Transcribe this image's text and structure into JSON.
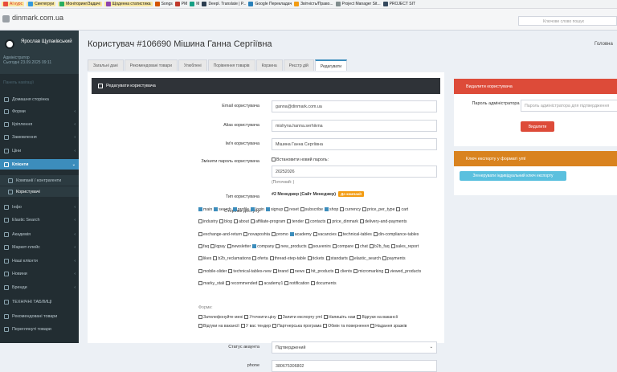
{
  "bookmarks": [
    "AI курс",
    "Синтегруи",
    "Моніторинг/Задачі",
    "Щоденна статистика",
    "Songs",
    "PM",
    "M",
    "Deepl. Translate | Р...",
    "Google Перекладач",
    "Звітність/Право...",
    "Project Manager Sit...",
    "PROJECT SIT"
  ],
  "site": "dinmark.com.ua",
  "search_placeholder": "Ключове слово пошук",
  "user": {
    "name": "Ярослав Щупаківський",
    "role": "Адміністратор",
    "today": "Сьогодні 23.09.2025 09:11"
  },
  "nav_header": "Панель навігації",
  "menu": [
    {
      "label": "Домашня сторінка",
      "chev": ""
    },
    {
      "label": "Форми",
      "chev": "‹"
    },
    {
      "label": "Кріплення",
      "chev": "‹"
    },
    {
      "label": "Замовлення",
      "chev": "‹"
    },
    {
      "label": "Ціни",
      "chev": "‹"
    },
    {
      "label": "Клієнти",
      "chev": "⌄"
    },
    {
      "label": "Компанії / контрагенти",
      "chev": ""
    },
    {
      "label": "Користувачі",
      "chev": ""
    },
    {
      "label": "Інфо",
      "chev": "‹"
    },
    {
      "label": "Elastic Search",
      "chev": "‹"
    },
    {
      "label": "Академія",
      "chev": "‹"
    },
    {
      "label": "Маркет-плейс",
      "chev": "‹"
    },
    {
      "label": "Наші клієнти",
      "chev": "‹"
    },
    {
      "label": "Новини",
      "chev": "‹"
    },
    {
      "label": "Бренди",
      "chev": "‹"
    },
    {
      "label": "ТЕХНІЧНІ ТАБЛИЦІ",
      "chev": ""
    },
    {
      "label": "Рекомендовані товари",
      "chev": ""
    },
    {
      "label": "Переглянуті товари",
      "chev": ""
    }
  ],
  "page_title": "Користувач #106690 Мішина Ганна Сергіївна",
  "breadcrumb": "Головна",
  "tabs": [
    "Загальні дані",
    "Рекомендовані товари",
    "Улюблені",
    "Порівняння товарів",
    "Корзина",
    "Реєстр дій",
    "Редагувати"
  ],
  "panel_title": "Редагувати користувача",
  "form": {
    "email_label": "Email користувача",
    "email": "ganna@dinmark.com.ua",
    "alias_label": "Alias користувача",
    "alias": "mishyna.hanna.serhiivna",
    "name_label": "Ім'я користувача",
    "name": "Мішина Ганна Сергіївна",
    "pass_label": "Змінити пароль користувача",
    "pass_check": "Встановити новий пароль:",
    "pass_value": "20252026",
    "pass_hint": "(Поточний: )",
    "type_label": "Тип користувача",
    "type_value": "#2 Менеджер (Сайт Менеджер)",
    "type_badge": "До компанії",
    "pages_label": "Сторінки доступу",
    "forms_caption": "Форми:",
    "status_label": "Статус акаунта",
    "status_value": "Підтверджений",
    "phone_label": "phone",
    "phone_value": "380675306802"
  },
  "access_rows": [
    [
      {
        "t": "main",
        "c": true
      },
      {
        "t": "search",
        "c": true
      },
      {
        "t": "profile",
        "c": true
      },
      {
        "t": "login",
        "c": true
      },
      {
        "t": "signup",
        "c": true
      },
      {
        "t": "reset",
        "c": false
      },
      {
        "t": "subscribe",
        "c": false
      },
      {
        "t": "shop",
        "c": true
      },
      {
        "t": "currency",
        "c": false
      },
      {
        "t": "price_per_type",
        "c": false
      },
      {
        "t": "cart",
        "c": false
      }
    ],
    [
      {
        "t": "industry",
        "c": false
      },
      {
        "t": "blog",
        "c": false
      },
      {
        "t": "about",
        "c": false
      },
      {
        "t": "affiliate-program",
        "c": false
      },
      {
        "t": "tender",
        "c": false
      },
      {
        "t": "contacts",
        "c": false
      },
      {
        "t": "price_dinmark",
        "c": false
      },
      {
        "t": "delivery-and-payments",
        "c": false
      }
    ],
    [
      {
        "t": "exchange-and-return",
        "c": false
      },
      {
        "t": "novaposhta",
        "c": false
      },
      {
        "t": "promo",
        "c": false
      },
      {
        "t": "academy",
        "c": true
      },
      {
        "t": "vacancies",
        "c": false
      },
      {
        "t": "technical-tables",
        "c": false
      },
      {
        "t": "din-compliance-tables",
        "c": false
      }
    ],
    [
      {
        "t": "faq",
        "c": false
      },
      {
        "t": "lqpay",
        "c": false
      },
      {
        "t": "newsletter",
        "c": false
      },
      {
        "t": "company",
        "c": true
      },
      {
        "t": "new_products",
        "c": false
      },
      {
        "t": "souvenirs",
        "c": false
      },
      {
        "t": "compare",
        "c": false
      },
      {
        "t": "chat",
        "c": false
      },
      {
        "t": "b2b_faq",
        "c": false
      },
      {
        "t": "sales_report",
        "c": false
      }
    ],
    [
      {
        "t": "likes",
        "c": false
      },
      {
        "t": "b2b_reclamations",
        "c": false
      },
      {
        "t": "oferta",
        "c": false
      },
      {
        "t": "thread-step-table",
        "c": false
      },
      {
        "t": "tickets",
        "c": false
      },
      {
        "t": "standarts",
        "c": false
      },
      {
        "t": "elastic_search",
        "c": false
      },
      {
        "t": "payments",
        "c": false
      }
    ],
    [
      {
        "t": "mobile-slider",
        "c": false
      },
      {
        "t": "technical-tables-new",
        "c": false
      },
      {
        "t": "brand",
        "c": false
      },
      {
        "t": "news",
        "c": false
      },
      {
        "t": "hit_products",
        "c": false
      },
      {
        "t": "clients",
        "c": false
      },
      {
        "t": "micromarking",
        "c": false
      },
      {
        "t": "viewed_products",
        "c": false
      }
    ],
    [
      {
        "t": "marky_stali",
        "c": false
      },
      {
        "t": "recommended",
        "c": false
      },
      {
        "t": "academy1",
        "c": false
      },
      {
        "t": "notification",
        "c": false
      },
      {
        "t": "documents",
        "c": false
      }
    ]
  ],
  "form_rows": [
    [
      {
        "t": "Зателефонуйте мені",
        "c": false
      },
      {
        "t": "Уточнити ціну",
        "c": false
      },
      {
        "t": "Запити експорту yml",
        "c": false
      },
      {
        "t": "Напишіть нам",
        "c": false
      },
      {
        "t": "Відгуки на вакансії",
        "c": false
      }
    ],
    [
      {
        "t": "Відгуки на вакансії",
        "c": false
      },
      {
        "t": "У вас тендер",
        "c": false
      },
      {
        "t": "Партнерська програма",
        "c": false
      },
      {
        "t": "Обмін та повернення",
        "c": false
      },
      {
        "t": "Надання зразків",
        "c": false
      }
    ]
  ],
  "right": {
    "del_title": "Видалити користувача",
    "del_label": "Пароль адміністратора",
    "del_placeholder": "Пароль адміністратора для підтвердження",
    "del_button": "Видалити",
    "export_title": "Ключ експорту у форматі yml",
    "export_button": "Згенерувати індивідуальний ключ експорту"
  },
  "colors": {
    "sidebar": "#222d32",
    "active": "#3c8dbc",
    "danger": "#dd4b39",
    "warn": "#d9831f",
    "info": "#5bc0de"
  }
}
